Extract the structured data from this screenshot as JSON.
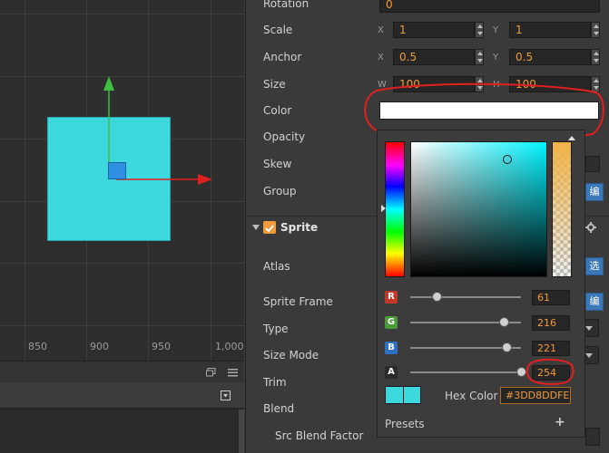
{
  "scene": {
    "ruler_ticks": [
      "850",
      "900",
      "950",
      "1,000"
    ]
  },
  "inspector": {
    "rotation": {
      "label": "Rotation",
      "value": "0"
    },
    "scale": {
      "label": "Scale",
      "x_axis": "X",
      "x": "1",
      "y_axis": "Y",
      "y": "1"
    },
    "anchor": {
      "label": "Anchor",
      "x_axis": "X",
      "x": "0.5",
      "y_axis": "Y",
      "y": "0.5"
    },
    "size": {
      "label": "Size",
      "w_axis": "W",
      "w": "100",
      "h_axis": "H",
      "h": "100"
    },
    "color": {
      "label": "Color",
      "value_hex": "#ffffff"
    },
    "opacity": {
      "label": "Opacity"
    },
    "skew": {
      "label": "Skew"
    },
    "group": {
      "label": "Group",
      "button": "编"
    },
    "sprite_section": {
      "title": "Sprite",
      "enabled": true
    },
    "atlas": {
      "label": "Atlas",
      "button": "选"
    },
    "sprite_frame": {
      "label": "Sprite Frame",
      "button": "编"
    },
    "type": {
      "label": "Type"
    },
    "size_mode": {
      "label": "Size Mode"
    },
    "trim": {
      "label": "Trim"
    },
    "blend": {
      "label": "Blend"
    },
    "src_blend_factor": {
      "label": "Src Blend Factor"
    }
  },
  "color_picker": {
    "selected_color": "#3dd8dd",
    "channels": [
      {
        "key": "R",
        "value": "61",
        "fraction": 0.239,
        "color": "#c0392b"
      },
      {
        "key": "G",
        "value": "216",
        "fraction": 0.847,
        "color": "#4a9a3a"
      },
      {
        "key": "B",
        "value": "221",
        "fraction": 0.867,
        "color": "#2d6fc0"
      },
      {
        "key": "A",
        "value": "254",
        "fraction": 0.996,
        "color": "#2a2a2a"
      }
    ],
    "hex_label": "Hex Color",
    "hex_value": "#3DD8DDFE",
    "presets_label": "Presets",
    "presets_add": "+"
  },
  "colors": {
    "scene_bg": "#2e2e2e",
    "selection_blue": "#3b78b8",
    "value_orange": "#f29a3c",
    "annotation_red": "#e02020"
  }
}
